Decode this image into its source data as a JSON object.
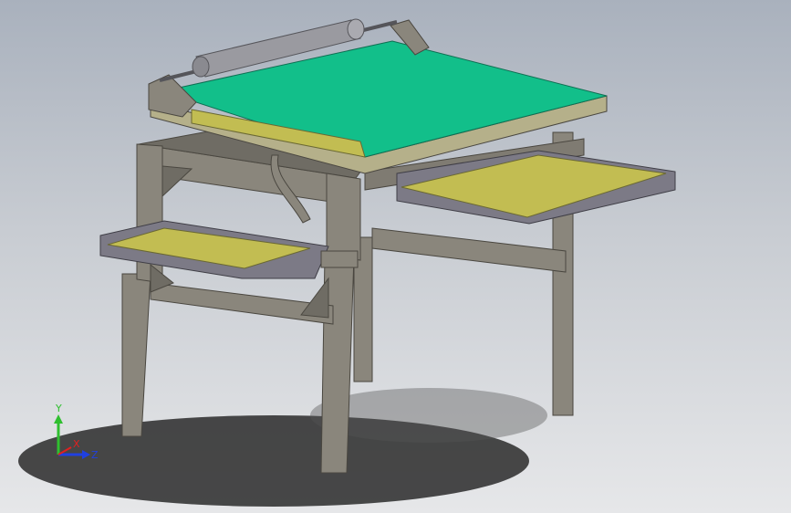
{
  "viewport": {
    "background_top": "#a9b1bd",
    "background_bottom": "#e6e7e9"
  },
  "colors": {
    "frame": "#8a867c",
    "frame_dark": "#5a574f",
    "table_top": "#12bf8a",
    "tray_fill": "#c2bd52",
    "tray_rim": "#7c7a86",
    "roller": "#9a9aa0"
  },
  "triad": {
    "y_label": "Y",
    "x_label": "X",
    "z_label": "Z",
    "y_color": "#2fbf2f",
    "x_color": "#e02020",
    "z_color": "#2040e0"
  }
}
